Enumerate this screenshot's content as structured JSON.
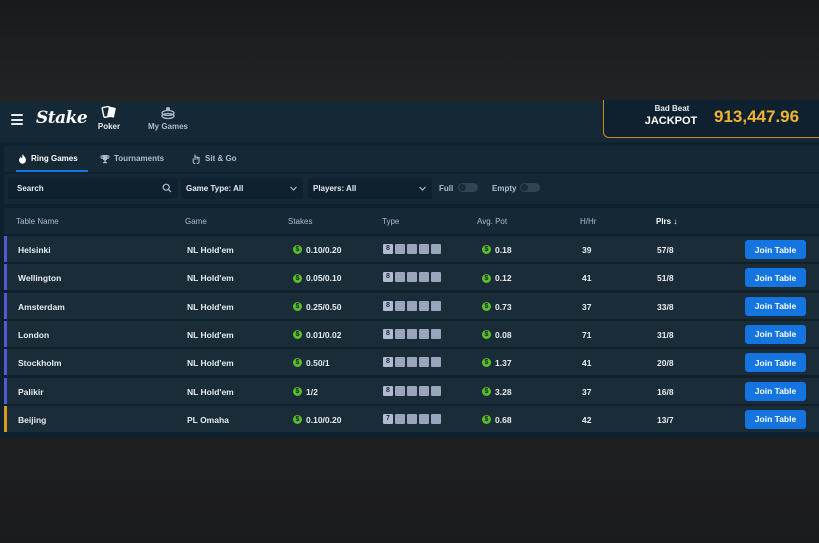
{
  "brand": {
    "logo_text": "Stake"
  },
  "nav": [
    {
      "label": "Poker"
    },
    {
      "label": "My Games"
    }
  ],
  "jackpot": {
    "line1": "Bad Beat",
    "line2": "JACKPOT",
    "value": "913,447.96",
    "accent": "#f2b233"
  },
  "tabs": [
    {
      "label": "Ring Games",
      "icon": "fire-icon",
      "active": true
    },
    {
      "label": "Tournaments",
      "icon": "trophy-icon",
      "active": false
    },
    {
      "label": "Sit & Go",
      "icon": "hand-icon",
      "active": false
    }
  ],
  "filters": {
    "search_placeholder": "Search",
    "game_type": "Game Type: All",
    "players": "Players: All",
    "full_label": "Full",
    "empty_label": "Empty",
    "full_on": false,
    "empty_on": false
  },
  "table": {
    "columns": [
      "Table Name",
      "Game",
      "Stakes",
      "Type",
      "Avg. Pot",
      "H/Hr",
      "Plrs ↓"
    ],
    "join_label": "Join Table",
    "rows": [
      {
        "name": "Helsinki",
        "game": "NL Hold'em",
        "stakes": "0.10/0.20",
        "seats": "8",
        "avg_pot": "0.18",
        "hhr": "39",
        "plrs": "57/8",
        "accent": "#4f5bd5"
      },
      {
        "name": "Wellington",
        "game": "NL Hold'em",
        "stakes": "0.05/0.10",
        "seats": "8",
        "avg_pot": "0.12",
        "hhr": "41",
        "plrs": "51/8",
        "accent": "#4f5bd5"
      },
      {
        "name": "Amsterdam",
        "game": "NL Hold'em",
        "stakes": "0.25/0.50",
        "seats": "8",
        "avg_pot": "0.73",
        "hhr": "37",
        "plrs": "33/8",
        "accent": "#4f5bd5"
      },
      {
        "name": "London",
        "game": "NL Hold'em",
        "stakes": "0.01/0.02",
        "seats": "8",
        "avg_pot": "0.08",
        "hhr": "71",
        "plrs": "31/8",
        "accent": "#4f5bd5"
      },
      {
        "name": "Stockholm",
        "game": "NL Hold'em",
        "stakes": "0.50/1",
        "seats": "8",
        "avg_pot": "1.37",
        "hhr": "41",
        "plrs": "20/8",
        "accent": "#4f5bd5"
      },
      {
        "name": "Palikir",
        "game": "NL Hold'em",
        "stakes": "1/2",
        "seats": "8",
        "avg_pot": "3.28",
        "hhr": "37",
        "plrs": "16/8",
        "accent": "#4f5bd5"
      },
      {
        "name": "Beijing",
        "game": "PL Omaha",
        "stakes": "0.10/0.20",
        "seats": "7",
        "avg_pot": "0.68",
        "hhr": "42",
        "plrs": "13/7",
        "accent": "#d89a1c"
      }
    ]
  },
  "colors": {
    "primary": "#1475e1",
    "coin": "#5bbf2c",
    "bg": "#0f212e",
    "row": "#1a2c38"
  }
}
